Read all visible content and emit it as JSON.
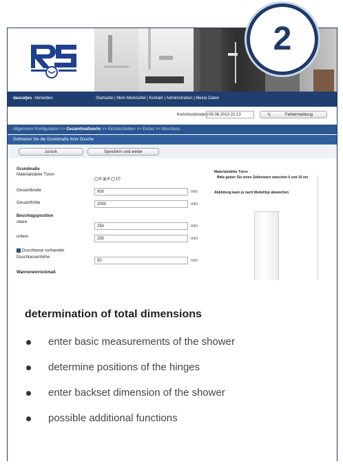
{
  "badge": {
    "number": "2"
  },
  "screenshot": {
    "logo_text": "RS",
    "navbar": {
      "user": "dascatjes",
      "logout": "Abmelden",
      "links": "Startseite | Mein Merkzettel | Kontakt | Administration | Meine Daten"
    },
    "commission": {
      "label": "Kommissionstext",
      "value": "06.08.2013 21:13",
      "error_button": "Fehlermeldung"
    },
    "steps": {
      "step1": "Allgemeine Konfiguration",
      "step2": "Gesamtmaßwerte",
      "step3": "Einzelscheiben",
      "step4": "Extras",
      "step5": "Abschluss",
      "sep": ">>"
    },
    "instruction": "Definieren Sie die Grundmaße Ihrer Dusche",
    "buttons": {
      "back": "zurück",
      "save": "Speichern und weiter"
    },
    "form": {
      "section_basic": "Grundmaße",
      "thickness_label": "Materialstärke Türen",
      "thickness_options": [
        "6",
        "8",
        "10"
      ],
      "thickness_selected": "8",
      "width_label": "Gesamtbreite",
      "width_value": "900",
      "height_label": "Gesamthöhe",
      "height_value": "2000",
      "unit": "mm",
      "section_hinge": "Beschlagsposition",
      "upper_label": "obere",
      "upper_value": "250",
      "lower_label": "untere",
      "lower_value": "250",
      "tray_checkbox": "Duschtasse vorhanden",
      "tray_height_label": "Duschtassenhöhe",
      "tray_height_value": "50",
      "section_backset": "Wanneneinrückmaß"
    },
    "side": {
      "title": "Materialstärke Türen",
      "hint": "Bitte geben Sie einen Zahlenwert zwischen 6 und 10 ein",
      "note": "Abbildung kann je nach Modelltyp abweichen"
    }
  },
  "text": {
    "heading": "determination of total dimensions",
    "bullets": [
      "enter basic measurements of the shower",
      "determine positions of the hinges",
      "enter backset dimension of the shower",
      "possible additional functions"
    ]
  }
}
